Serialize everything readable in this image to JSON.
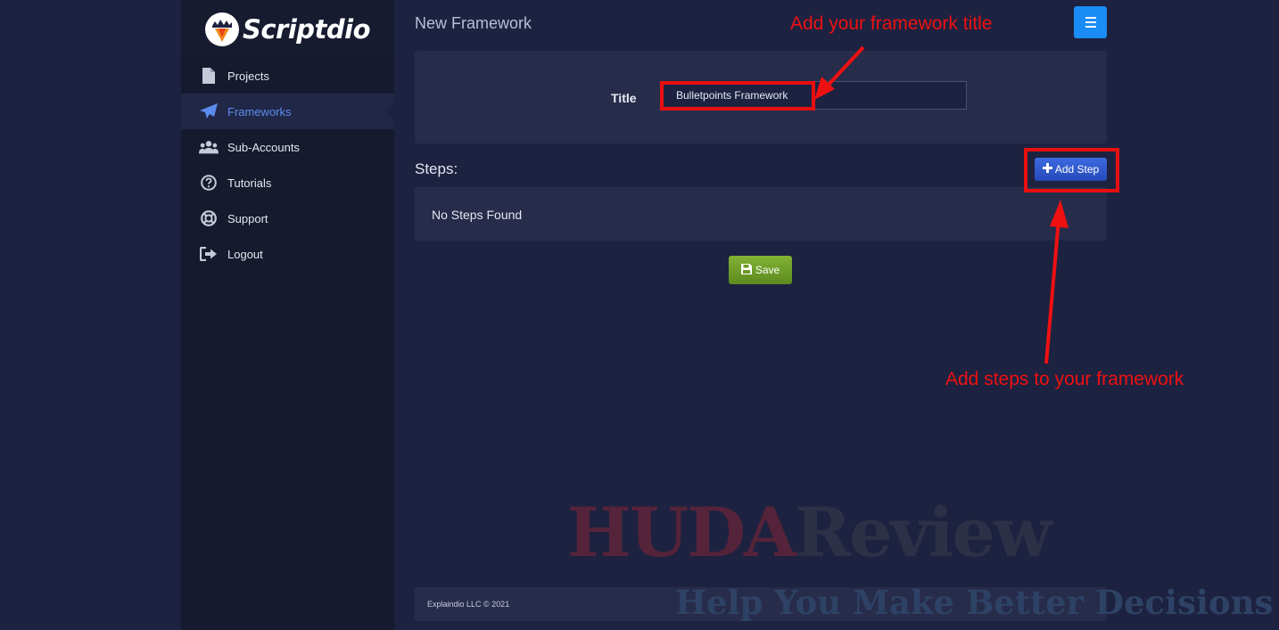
{
  "brand": {
    "name": "Scriptdio"
  },
  "sidebar": {
    "items": [
      {
        "label": "Projects",
        "icon": "file-icon",
        "active": false
      },
      {
        "label": "Frameworks",
        "icon": "paper-plane-icon",
        "active": true
      },
      {
        "label": "Sub-Accounts",
        "icon": "users-icon",
        "active": false
      },
      {
        "label": "Tutorials",
        "icon": "question-circle-icon",
        "active": false
      },
      {
        "label": "Support",
        "icon": "lifebuoy-icon",
        "active": false
      },
      {
        "label": "Logout",
        "icon": "sign-out-icon",
        "active": false
      }
    ]
  },
  "header": {
    "title": "New Framework",
    "menu_icon": "hamburger-icon"
  },
  "form": {
    "title_label": "Title",
    "title_value": "Bulletpoints Framework"
  },
  "steps": {
    "label": "Steps:",
    "add_label": "Add Step",
    "empty_text": "No Steps Found"
  },
  "actions": {
    "save_label": "Save"
  },
  "footer": {
    "text": "Explaindio LLC © 2021"
  },
  "annotations": {
    "title_hint": "Add your framework title",
    "steps_hint": "Add steps to your framework"
  },
  "watermark": {
    "part1": "HUDA",
    "part2": "Review",
    "tagline": "Help You Make Better Decisions"
  },
  "colors": {
    "background": "#1d2240",
    "sidebar": "#161a2e",
    "accent_blue": "#1a8cf5",
    "active_nav": "#5b8def",
    "save_green": "#6fa128",
    "annotation_red": "#ee1111"
  }
}
